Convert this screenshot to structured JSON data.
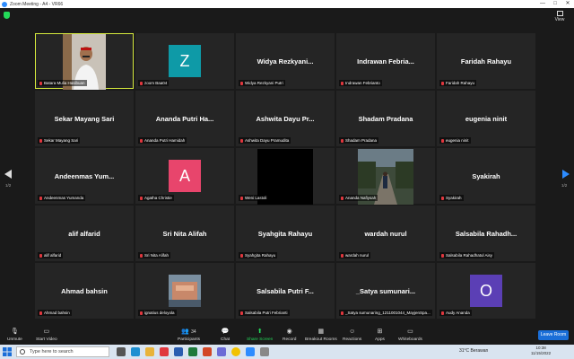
{
  "window": {
    "title": "Zoom Meeting - A4 - VR66",
    "min": "—",
    "max": "□",
    "close": "✕"
  },
  "top": {
    "view_label": "View"
  },
  "pager": {
    "left": "1/2",
    "right": "1/2"
  },
  "tiles": [
    {
      "type": "photo",
      "big": "",
      "label": "Batara Mulia Hasibuan",
      "active": true
    },
    {
      "type": "avatar",
      "letter": "Z",
      "color": "#0e9aa7",
      "big": "",
      "label": "zoom Baa04"
    },
    {
      "type": "name",
      "big": "Widya Rezkyani...",
      "label": "Widya Rezkyani Putri"
    },
    {
      "type": "name",
      "big": "Indrawan Febria...",
      "label": "Indrawan Febrianto"
    },
    {
      "type": "name",
      "big": "Faridah Rahayu",
      "label": "Faridah Rahayu"
    },
    {
      "type": "name",
      "big": "Sekar Mayang Sari",
      "label": "Sekar Mayang Sari"
    },
    {
      "type": "name",
      "big": "Ananda Putri Ha...",
      "label": "Ananda Putri Hamidah"
    },
    {
      "type": "name",
      "big": "Ashwita Dayu Pr...",
      "label": "Ashwita Dayu Pramudita"
    },
    {
      "type": "name",
      "big": "Shadam Pradana",
      "label": "Shadam Pradana"
    },
    {
      "type": "name",
      "big": "eugenia ninit",
      "label": "eugenia ninit"
    },
    {
      "type": "name",
      "big": "Andeenmas  Yum...",
      "label": "Andeenmas Yumanda"
    },
    {
      "type": "avatar",
      "letter": "A",
      "color": "#e8456c",
      "big": "",
      "label": "Agatha Christie"
    },
    {
      "type": "black",
      "big": "",
      "label": "Weni Lastoli"
    },
    {
      "type": "street",
      "big": "",
      "label": "Ananda Nafiysah"
    },
    {
      "type": "name",
      "big": "Syakirah",
      "label": "Syakirah"
    },
    {
      "type": "name",
      "big": "alif alfarid",
      "label": "alif alfarid"
    },
    {
      "type": "name",
      "big": "Sri Nita Alifah",
      "label": "Sri Nita Alifah"
    },
    {
      "type": "name",
      "big": "Syahgita Rahayu",
      "label": "Syahgita Rahayu"
    },
    {
      "type": "name",
      "big": "wardah nurul",
      "label": "wardah nurul"
    },
    {
      "type": "name",
      "big": "Salsabila  Rahadh...",
      "label": "Salsabila Rahadhatul Aisy"
    },
    {
      "type": "name",
      "big": "Ahmad bahsin",
      "label": "Ahmad bahsin"
    },
    {
      "type": "thumb",
      "big": "",
      "label": "ignatius deloyola"
    },
    {
      "type": "name",
      "big": "Salsabila Putri F...",
      "label": "Salsabila Putri Febrianti"
    },
    {
      "type": "name",
      "big": "_Satya  sumunari...",
      "label": "_Satya sumunaring_1211001044_MayjenSpa..."
    },
    {
      "type": "avatar",
      "letter": "O",
      "color": "#5b3fb5",
      "big": "",
      "label": "Audy Ananda"
    }
  ],
  "toolbar": {
    "unmute": "Unmute",
    "start_video": "Start Video",
    "participants": "Participants",
    "participants_count": "34",
    "chat": "Chat",
    "share": "Share Screen",
    "record": "Record",
    "breakout": "Breakout Rooms",
    "reactions": "Reactions",
    "apps": "Apps",
    "whiteboards": "Whiteboards",
    "leave": "Leave Room"
  },
  "taskbar": {
    "search_placeholder": "Type here to search",
    "weather": "31°C  Berawan",
    "time": "10:38",
    "date": "11/15/2022"
  }
}
